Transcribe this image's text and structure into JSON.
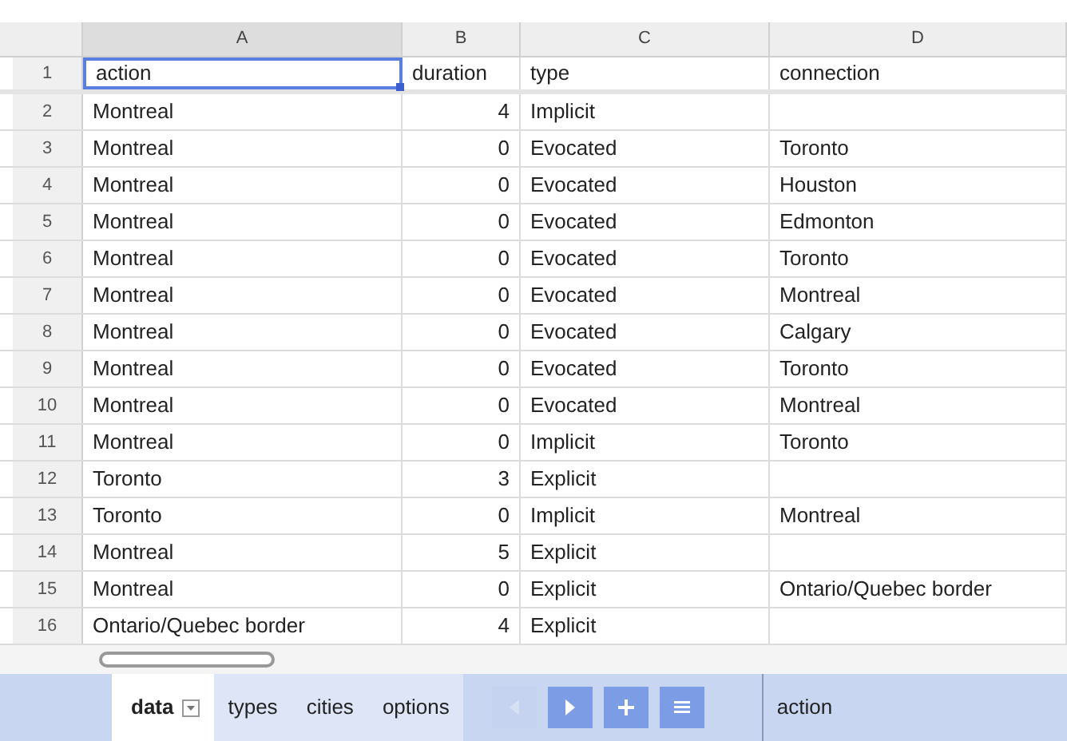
{
  "columns": [
    "A",
    "B",
    "C",
    "D"
  ],
  "rows": [
    {
      "number": "1",
      "cells": [
        {
          "text": "action",
          "selected": true
        },
        {
          "text": "duration",
          "selected": false
        },
        {
          "text": "type",
          "selected": false
        },
        {
          "text": "connection",
          "selected": false
        }
      ]
    },
    {
      "number": "2",
      "cells": [
        {
          "text": "Montreal",
          "selected": false
        },
        {
          "text": "4",
          "selected": false
        },
        {
          "text": "Implicit",
          "selected": false
        },
        {
          "selected": false
        }
      ]
    },
    {
      "number": "3",
      "cells": [
        {
          "text": "Montreal",
          "selected": false
        },
        {
          "text": "0",
          "selected": false
        },
        {
          "text": "Evocated",
          "selected": false
        },
        {
          "text": "Toronto",
          "selected": false
        }
      ]
    },
    {
      "number": "4",
      "cells": [
        {
          "text": "Montreal",
          "selected": false
        },
        {
          "text": "0",
          "selected": false
        },
        {
          "text": "Evocated",
          "selected": false
        },
        {
          "text": "Houston",
          "selected": false
        }
      ]
    },
    {
      "number": "5",
      "cells": [
        {
          "text": "Montreal",
          "selected": false
        },
        {
          "text": "0",
          "selected": false
        },
        {
          "text": "Evocated",
          "selected": false
        },
        {
          "text": "Edmonton",
          "selected": false
        }
      ]
    },
    {
      "number": "6",
      "cells": [
        {
          "text": "Montreal",
          "selected": false
        },
        {
          "text": "0",
          "selected": false
        },
        {
          "text": "Evocated",
          "selected": false
        },
        {
          "text": "Toronto",
          "selected": false
        }
      ]
    },
    {
      "number": "7",
      "cells": [
        {
          "text": "Montreal",
          "selected": false
        },
        {
          "text": "0",
          "selected": false
        },
        {
          "text": "Evocated",
          "selected": false
        },
        {
          "text": "Montreal",
          "selected": false
        }
      ]
    },
    {
      "number": "8",
      "cells": [
        {
          "text": "Montreal",
          "selected": false
        },
        {
          "text": "0",
          "selected": false
        },
        {
          "text": "Evocated",
          "selected": false
        },
        {
          "text": "Calgary",
          "selected": false
        }
      ]
    },
    {
      "number": "9",
      "cells": [
        {
          "text": "Montreal",
          "selected": false
        },
        {
          "text": "0",
          "selected": false
        },
        {
          "text": "Evocated",
          "selected": false
        },
        {
          "text": "Toronto",
          "selected": false
        }
      ]
    },
    {
      "number": "10",
      "cells": [
        {
          "text": "Montreal",
          "selected": false
        },
        {
          "text": "0",
          "selected": false
        },
        {
          "text": "Evocated",
          "selected": false
        },
        {
          "text": "Montreal",
          "selected": false
        }
      ]
    },
    {
      "number": "11",
      "cells": [
        {
          "text": "Montreal",
          "selected": false
        },
        {
          "text": "0",
          "selected": false
        },
        {
          "text": "Implicit",
          "selected": false
        },
        {
          "text": "Toronto",
          "selected": false
        }
      ]
    },
    {
      "number": "12",
      "cells": [
        {
          "text": "Toronto",
          "selected": false
        },
        {
          "text": "3",
          "selected": false
        },
        {
          "text": "Explicit",
          "selected": false
        },
        {
          "selected": false
        }
      ]
    },
    {
      "number": "13",
      "cells": [
        {
          "text": "Toronto",
          "selected": false
        },
        {
          "text": "0",
          "selected": false
        },
        {
          "text": "Implicit",
          "selected": false
        },
        {
          "text": "Montreal",
          "selected": false
        }
      ]
    },
    {
      "number": "14",
      "cells": [
        {
          "text": "Montreal",
          "selected": false
        },
        {
          "text": "5",
          "selected": false
        },
        {
          "text": "Explicit",
          "selected": false
        },
        {
          "selected": false
        }
      ]
    },
    {
      "number": "15",
      "cells": [
        {
          "text": "Montreal",
          "selected": false
        },
        {
          "text": "0",
          "selected": false
        },
        {
          "text": "Explicit",
          "selected": false
        },
        {
          "text": "Ontario/Quebec border",
          "selected": false
        }
      ]
    },
    {
      "number": "16",
      "cells": [
        {
          "text": "Ontario/Quebec border",
          "selected": false
        },
        {
          "text": "4",
          "selected": false
        },
        {
          "text": "Explicit",
          "selected": false
        },
        {
          "selected": false
        }
      ]
    }
  ],
  "sheet_tabs": [
    {
      "label": "data",
      "selected": true
    },
    {
      "label": "types",
      "selected": false
    },
    {
      "label": "cities",
      "selected": false
    },
    {
      "label": "options",
      "selected": false
    }
  ],
  "nav_buttons": [
    {
      "kind": "prev",
      "disabled": true
    },
    {
      "kind": "next",
      "disabled": false
    },
    {
      "kind": "add",
      "disabled": false
    },
    {
      "kind": "list",
      "disabled": false
    }
  ],
  "cell_value": "action"
}
